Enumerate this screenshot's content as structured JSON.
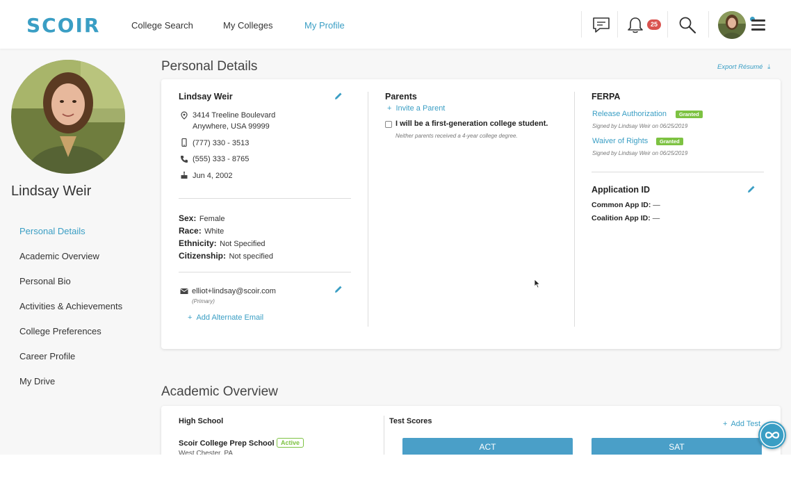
{
  "app": {
    "logo": "SCOIR"
  },
  "nav": {
    "college_search": "College Search",
    "my_colleges": "My Colleges",
    "my_profile": "My Profile"
  },
  "header": {
    "notification_count": "25",
    "icons": [
      "chat-icon",
      "bell-icon",
      "search-icon",
      "avatar",
      "menu-icon"
    ]
  },
  "profile": {
    "name": "Lindsay Weir"
  },
  "sidebar": {
    "items": [
      {
        "label": "Personal Details",
        "active": true
      },
      {
        "label": "Academic Overview"
      },
      {
        "label": "Personal Bio"
      },
      {
        "label": "Activities & Achievements"
      },
      {
        "label": "College Preferences"
      },
      {
        "label": "Career Profile"
      },
      {
        "label": "My Drive"
      }
    ]
  },
  "personal_details": {
    "title": "Personal Details",
    "export_label": "Export Résumé",
    "contact": {
      "name": "Lindsay Weir",
      "address_line1": "3414 Treeline Boulevard",
      "address_line2": "Anywhere, USA 99999",
      "mobile": "(777) 330 - 3513",
      "phone": "(555) 333 - 8765",
      "birthday": "Jun 4, 2002"
    },
    "demographics": {
      "sex_label": "Sex:",
      "sex": "Female",
      "race_label": "Race:",
      "race": "White",
      "ethnicity_label": "Ethnicity:",
      "ethnicity": "Not Specified",
      "citizenship_label": "Citizenship:",
      "citizenship": "Not specified"
    },
    "email": {
      "address": "elliot+lindsay@scoir.com",
      "type": "(Primary)",
      "add_label": "Add Alternate Email"
    },
    "parents": {
      "title": "Parents",
      "invite_label": "Invite a Parent",
      "first_gen_label": "I will be a first-generation college student.",
      "first_gen_note": "Neither parents received a 4-year college degree."
    },
    "ferpa": {
      "title": "FERPA",
      "release_label": "Release Authorization",
      "release_status": "Granted",
      "release_signed": "Signed by Lindsay Weir on 06/25/2019",
      "waiver_label": "Waiver of Rights",
      "waiver_status": "Granted",
      "waiver_signed": "Signed by Lindsay Weir on 06/25/2019"
    },
    "application_id": {
      "title": "Application ID",
      "common_label": "Common App ID:",
      "common_value": "—",
      "coalition_label": "Coalition App ID:",
      "coalition_value": "—"
    }
  },
  "academic_overview": {
    "title": "Academic Overview",
    "high_school_title": "High School",
    "school_name": "Scoir College Prep School",
    "school_status": "Active",
    "school_location": "West Chester, PA",
    "test_scores_title": "Test Scores",
    "add_test_label": "Add Test",
    "tabs": [
      "ACT",
      "SAT"
    ]
  },
  "colors": {
    "accent": "#3a9ec4",
    "granted": "#7dc242",
    "badge": "#d9534f"
  }
}
